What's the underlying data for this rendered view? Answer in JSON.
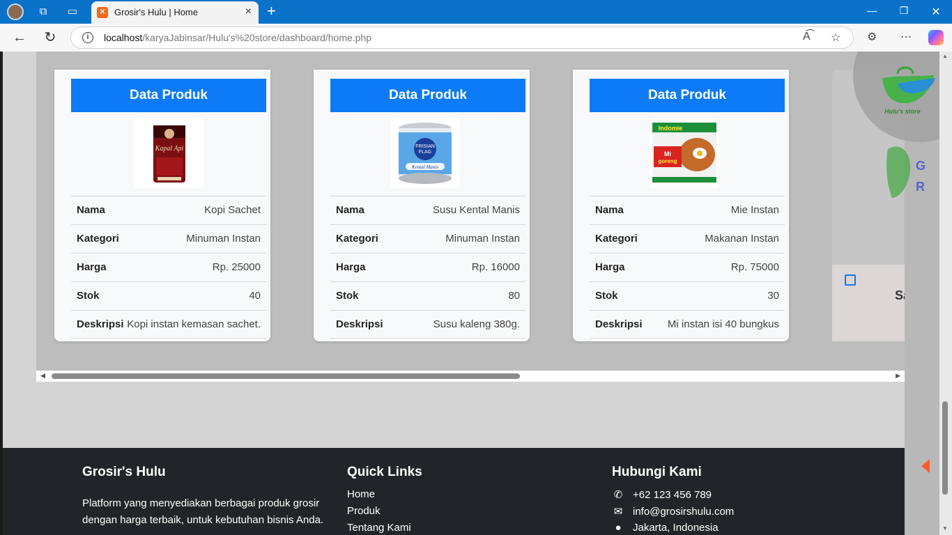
{
  "browser": {
    "tab_title": "Grosir's Hulu | Home",
    "url_host": "localhost",
    "url_path": "/karyaJabinsar/Hulu's%20store/dashboard/home.php"
  },
  "cards": [
    {
      "header": "Data Produk",
      "image_icon": "kopi-sachet-image",
      "rows": [
        {
          "label": "Nama",
          "value": "Kopi Sachet"
        },
        {
          "label": "Kategori",
          "value": "Minuman Instan"
        },
        {
          "label": "Harga",
          "value": "Rp. 25000"
        },
        {
          "label": "Stok",
          "value": "40"
        },
        {
          "label": "Deskripsi",
          "value": "Kopi instan kemasan sachet."
        }
      ]
    },
    {
      "header": "Data Produk",
      "image_icon": "susu-kental-manis-image",
      "rows": [
        {
          "label": "Nama",
          "value": "Susu Kental Manis"
        },
        {
          "label": "Kategori",
          "value": "Minuman Instan"
        },
        {
          "label": "Harga",
          "value": "Rp. 16000"
        },
        {
          "label": "Stok",
          "value": "80"
        },
        {
          "label": "Deskripsi",
          "value": "Susu kaleng 380g."
        }
      ]
    },
    {
      "header": "Data Produk",
      "image_icon": "mie-instan-image",
      "rows": [
        {
          "label": "Nama",
          "value": "Mie Instan"
        },
        {
          "label": "Kategori",
          "value": "Makanan Instan"
        },
        {
          "label": "Harga",
          "value": "Rp. 75000"
        },
        {
          "label": "Stok",
          "value": "30"
        },
        {
          "label": "Deskripsi",
          "value": "Mi instan isi 40 bungkus"
        }
      ]
    }
  ],
  "partial_card": {
    "text": "Sa"
  },
  "sidebar": {
    "logo_text": "Hulu's store",
    "letters": [
      "G",
      "R"
    ]
  },
  "footer": {
    "brand_title": "Grosir's Hulu",
    "brand_desc": "Platform yang menyediakan berbagai produk grosir dengan harga terbaik, untuk kebutuhan bisnis Anda.",
    "links_title": "Quick Links",
    "links": [
      "Home",
      "Produk",
      "Tentang Kami"
    ],
    "contact_title": "Hubungi Kami",
    "phone": "+62 123 456 789",
    "email": "info@grosirshulu.com",
    "address": "Jakarta, Indonesia"
  },
  "colors": {
    "primary": "#0d7bf7",
    "footer_bg": "#212529",
    "accent_arrow": "#ff5a2a"
  }
}
